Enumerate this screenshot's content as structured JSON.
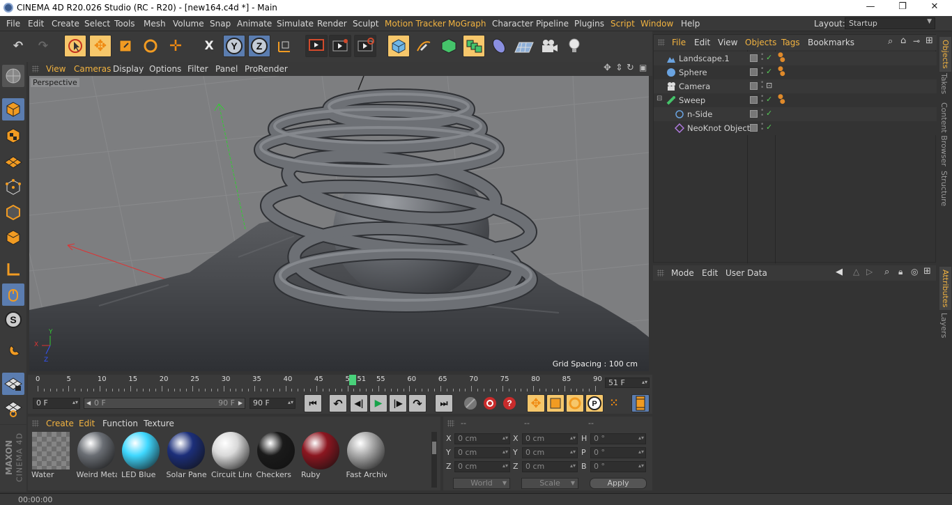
{
  "window": {
    "title": "CINEMA 4D R20.026 Studio (RC - R20) - [new164.c4d *] - Main",
    "minimize": "—",
    "restore": "❐",
    "close": "✕"
  },
  "menu": {
    "items": [
      "File",
      "Edit",
      "Create",
      "Select",
      "Tools",
      "Mesh",
      "Volume",
      "Snap",
      "Animate",
      "Simulate",
      "Render",
      "Sculpt",
      "Motion Tracker",
      "MoGraph",
      "Character",
      "Pipeline",
      "Plugins",
      "Script",
      "Window",
      "Help"
    ],
    "layout_label": "Layout:",
    "layout_value": "Startup"
  },
  "viewport": {
    "menu": [
      "View",
      "Cameras",
      "Display",
      "Options",
      "Filter",
      "Panel",
      "ProRender"
    ],
    "camera_label": "Perspective",
    "grid_spacing": "Grid Spacing : 100 cm",
    "axes": {
      "x": "X",
      "y": "Y",
      "z": "Z"
    }
  },
  "timeline": {
    "ticks": [
      "0",
      "5",
      "10",
      "15",
      "20",
      "25",
      "30",
      "35",
      "40",
      "45",
      "50",
      "55",
      "60",
      "65",
      "70",
      "75",
      "80",
      "85",
      "90"
    ],
    "current_frame_marker": "51",
    "current_frame": 51,
    "last_frame": 90,
    "frame_field": "51 F"
  },
  "playback": {
    "start": "0 F",
    "range_start": "0 F",
    "range_end": "90 F",
    "end": "90 F"
  },
  "materials": {
    "menu": [
      "Create",
      "Edit",
      "Function",
      "Texture"
    ],
    "items": [
      {
        "name": "Water",
        "color": "#8a8f95"
      },
      {
        "name": "Weird Meta",
        "color": "#6a6e74"
      },
      {
        "name": "LED Blue",
        "color": "#3fd8ff"
      },
      {
        "name": "Solar Panel",
        "color": "#1c2f7a"
      },
      {
        "name": "Circuit Line",
        "color": "#d9d9d9"
      },
      {
        "name": "Checkers",
        "color": "#1a1a1a"
      },
      {
        "name": "Ruby",
        "color": "#8c1620"
      },
      {
        "name": "Fast Archivi",
        "color": "#a9a9a9"
      }
    ]
  },
  "coords": {
    "headers": [
      "--",
      "--",
      "--"
    ],
    "rows": [
      {
        "a": "X",
        "av": "0 cm",
        "b": "X",
        "bv": "0 cm",
        "c": "H",
        "cv": "0 °"
      },
      {
        "a": "Y",
        "av": "0 cm",
        "b": "Y",
        "bv": "0 cm",
        "c": "P",
        "cv": "0 °"
      },
      {
        "a": "Z",
        "av": "0 cm",
        "b": "Z",
        "bv": "0 cm",
        "c": "B",
        "cv": "0 °"
      }
    ],
    "world": "World",
    "scale": "Scale",
    "apply": "Apply"
  },
  "objects": {
    "menu": [
      "File",
      "Edit",
      "View",
      "Objects",
      "Tags",
      "Bookmarks"
    ],
    "items": [
      {
        "name": "Landscape.1",
        "icon": "landscape-icon"
      },
      {
        "name": "Sphere",
        "icon": "sphere-icon"
      },
      {
        "name": "Camera",
        "icon": "camera-icon"
      },
      {
        "name": "Sweep",
        "icon": "sweep-icon"
      },
      {
        "name": "n-Side",
        "icon": "nside-icon"
      },
      {
        "name": "NeoKnot Object",
        "icon": "neoknot-icon"
      }
    ]
  },
  "attributes": {
    "menu": [
      "Mode",
      "Edit",
      "User Data"
    ]
  },
  "side_tabs": {
    "top": [
      "Objects",
      "Takes",
      "Content Browser",
      "Structure"
    ],
    "bottom": [
      "Attributes",
      "Layers"
    ]
  },
  "status": {
    "time": "00:00:00"
  },
  "brand": {
    "maxon": "MAXON",
    "product": "CINEMA 4D"
  },
  "colors": {
    "accent": "#f2b340",
    "highlight_button": "#f6c76b",
    "frame_marker": "#49d17a"
  }
}
